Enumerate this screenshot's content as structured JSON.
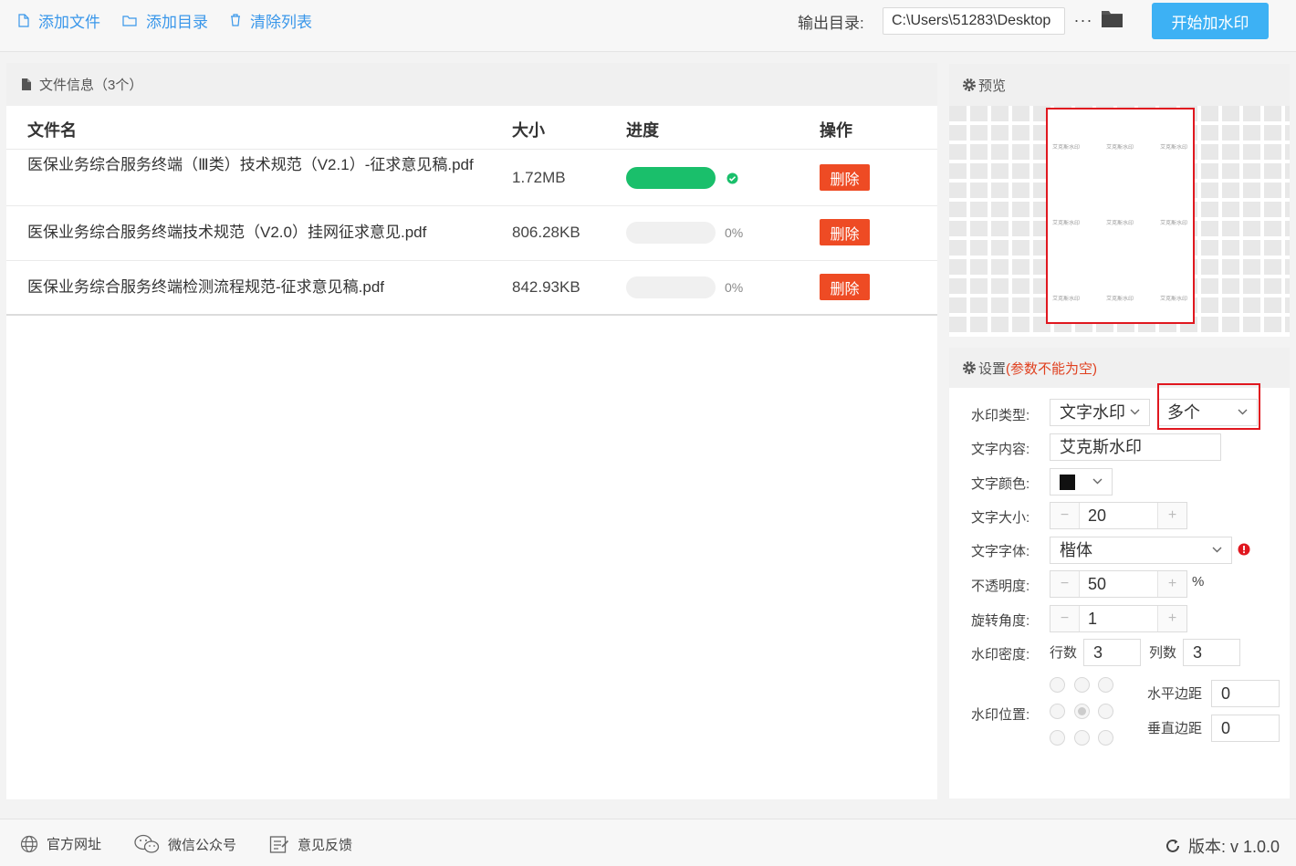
{
  "toolbar": {
    "add_file": "添加文件",
    "add_dir": "添加目录",
    "clear_list": "清除列表",
    "output_label": "输出目录:",
    "output_path": "C:\\Users\\51283\\Desktop",
    "more": "···",
    "start": "开始加水印"
  },
  "file_panel": {
    "title": "文件信息（3个）",
    "columns": {
      "name": "文件名",
      "size": "大小",
      "progress": "进度",
      "action": "操作"
    },
    "files": [
      {
        "name": "医保业务综合服务终端（Ⅲ类）技术规范（V2.1）-征求意见稿.pdf",
        "size": "1.72MB",
        "progress": 1.0,
        "progress_text": "",
        "done": true,
        "action": "删除"
      },
      {
        "name": "医保业务综合服务终端技术规范（V2.0）挂网征求意见.pdf",
        "size": "806.28KB",
        "progress": 0.0,
        "progress_text": "0%",
        "done": false,
        "action": "删除"
      },
      {
        "name": "医保业务综合服务终端检测流程规范-征求意见稿.pdf",
        "size": "842.93KB",
        "progress": 0.0,
        "progress_text": "0%",
        "done": false,
        "action": "删除"
      }
    ]
  },
  "preview": {
    "title": "预览",
    "watermark_text": "艾克斯水印"
  },
  "settings": {
    "title": "设置",
    "note": "(参数不能为空)",
    "type_label": "水印类型:",
    "type_value": "文字水印",
    "mode_value": "多个",
    "content_label": "文字内容:",
    "content_value": "艾克斯水印",
    "color_label": "文字颜色:",
    "color_value": "#111111",
    "size_label": "文字大小:",
    "size_value": "20",
    "font_label": "文字字体:",
    "font_value": "楷体",
    "opacity_label": "不透明度:",
    "opacity_value": "50",
    "opacity_unit": "%",
    "rotate_label": "旋转角度:",
    "rotate_value": "1",
    "density_label": "水印密度:",
    "rows_label": "行数",
    "rows_value": "3",
    "cols_label": "列数",
    "cols_value": "3",
    "position_label": "水印位置:",
    "position_selected": "center",
    "h_margin_label": "水平边距",
    "h_margin_value": "0",
    "v_margin_label": "垂直边距",
    "v_margin_value": "0",
    "minus": "−",
    "plus": "+"
  },
  "footer": {
    "website": "官方网址",
    "wechat": "微信公众号",
    "feedback": "意见反馈",
    "version": "版本:  v 1.0.0"
  },
  "colors": {
    "accent": "#3db1f4",
    "link": "#3a97ea",
    "danger": "#ee4b24",
    "success": "#1abf6b",
    "highlight": "#e0171f"
  }
}
